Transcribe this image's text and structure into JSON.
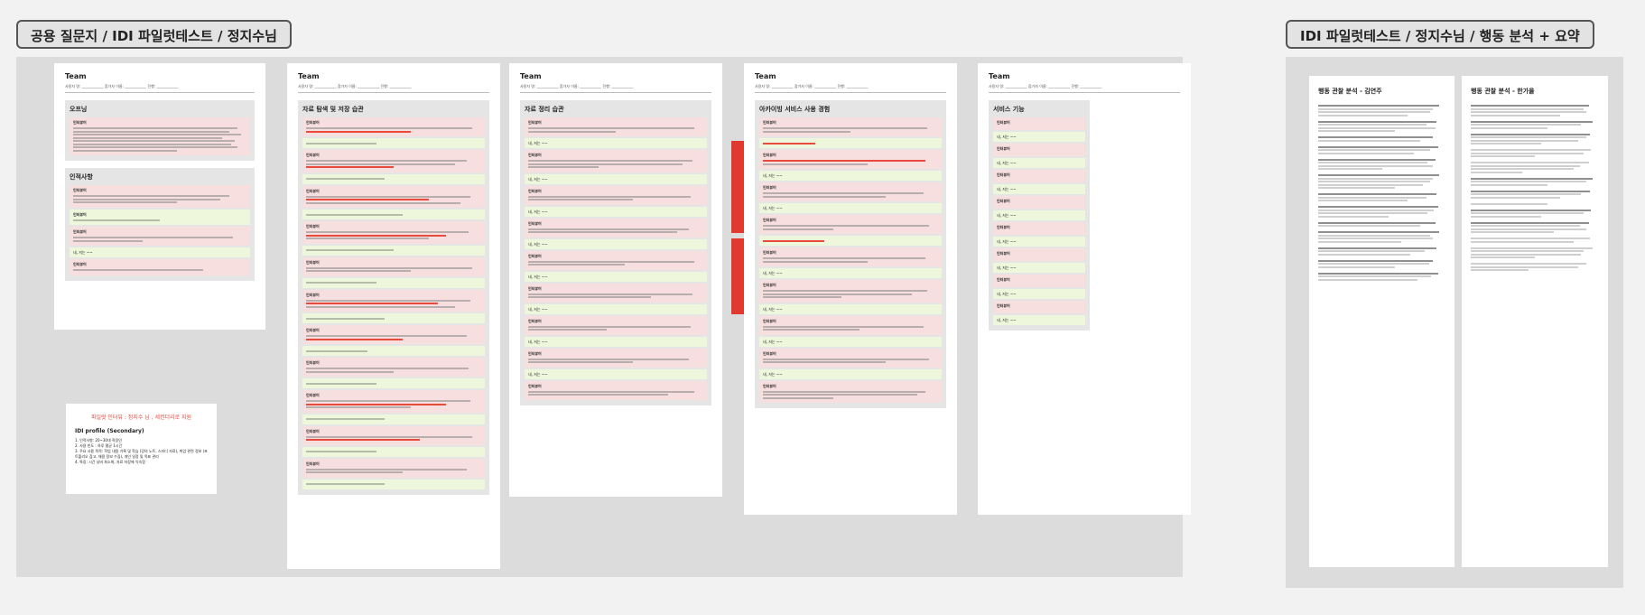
{
  "headers": {
    "left": "공용 질문지 / IDI 파일럿테스트 / 정지수님",
    "right": "IDI 파일럿테스트 / 정지수님 / 행동 분석 + 요약"
  },
  "common": {
    "team": "Team",
    "meta": "사용자 명: ____________   참가자 이름: ____________   진행: ____________",
    "interviewer": "인터뷰어",
    "answer_short": "네, 저는 ~~"
  },
  "pages": {
    "p1": {
      "s1": "오프닝",
      "s2": "인적사항"
    },
    "p2": {
      "s1": "자료 탐색 및 저장 습관"
    },
    "p3": {
      "s1": "자료 정리 습관"
    },
    "p4": {
      "s1": "아카이빙 서비스 사용 경험",
      "tab1": "다시\n확인\n했다",
      "tab2": "다시\n확인"
    },
    "p5": {
      "s1": "서비스 기능"
    }
  },
  "profile": {
    "title": "파일럿 인터뷰 : 정지수 님 , 세컨더리로 지원",
    "subtitle": "IDI profile (Secondary)",
    "items": [
      "1. 인적사항: 20~30대 직장인",
      "2. 사용 빈도 : 하루 평균 1시간",
      "3. 주요 사용 목적: 학업 내용 기록 및 학습 (강의 노트, 스터디 자료), 취업 관련 정보 (포트폴리오 참고, 채용 정보 수집), 개인 일정 및 목표 관리",
      "4. 특징: 시간 낭비 최소화, 자료 저장에 익숙함"
    ]
  },
  "right": {
    "left_title": "행동 관찰 분석 - 김연주",
    "right_title": "행동 관찰 분석 - 한가을"
  }
}
